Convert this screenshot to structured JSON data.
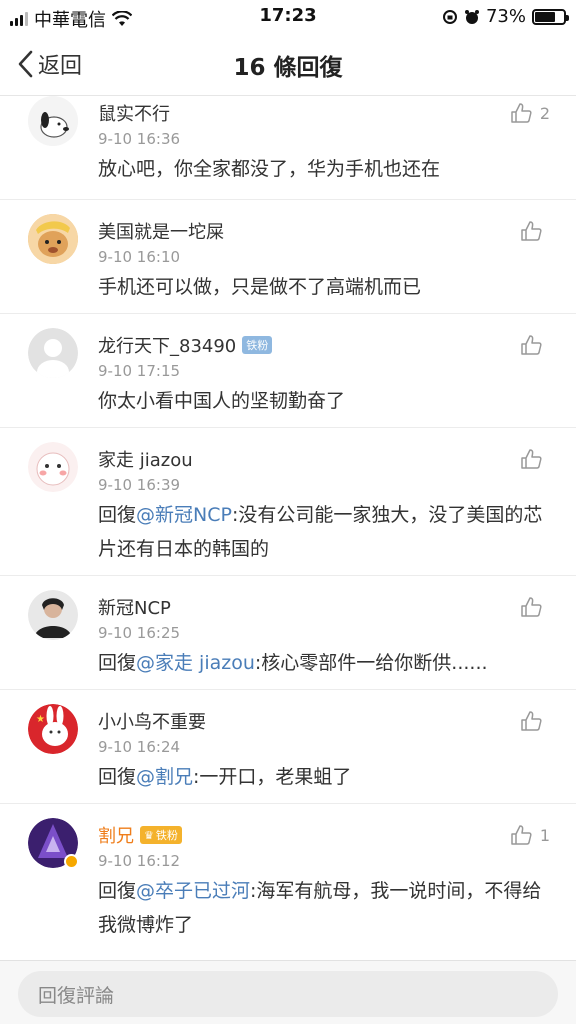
{
  "status_bar": {
    "carrier": "中華電信",
    "time": "17:23",
    "battery": "73%",
    "battery_level": 0.73
  },
  "nav": {
    "back_label": "返回",
    "title": "16 條回復"
  },
  "comments": [
    {
      "name": "鼠实不行",
      "time": "9-10 16:36",
      "text": "放心吧，你全家都没了，华为手机也还在",
      "likes": "2"
    },
    {
      "name": "美国就是一坨屎",
      "time": "9-10 16:10",
      "text": "手机还可以做，只是做不了高端机而已",
      "likes": ""
    },
    {
      "name": "龙行天下_83490",
      "badge": "铁粉",
      "time": "9-10 17:15",
      "text": "你太小看中国人的坚韧勤奋了",
      "likes": ""
    },
    {
      "name": "家走 jiazou",
      "time": "9-10 16:39",
      "reply_prefix": "回復",
      "mention": "@新冠NCP",
      "reply_text": ":没有公司能一家独大，没了美国的芯片还有日本的韩国的",
      "likes": ""
    },
    {
      "name": "新冠NCP",
      "time": "9-10 16:25",
      "reply_prefix": "回復",
      "mention": "@家走 jiazou",
      "reply_text": ":核心零部件一给你断供......",
      "likes": ""
    },
    {
      "name": "小小鸟不重要",
      "time": "9-10 16:24",
      "reply_prefix": "回復",
      "mention": "@割兄",
      "reply_text": ":一开口，老果蛆了",
      "likes": ""
    },
    {
      "name": "割兄",
      "badge": "铁粉",
      "time": "9-10 16:12",
      "reply_prefix": "回復",
      "mention": "@卒子已过河",
      "reply_text": ":海军有航母，我一说时间，不得给我微博炸了",
      "likes": "1"
    }
  ],
  "input": {
    "placeholder": "回復評論"
  },
  "colors": {
    "mention": "#4a7db8",
    "vip_name": "#ef7d1a",
    "muted": "#999999"
  }
}
